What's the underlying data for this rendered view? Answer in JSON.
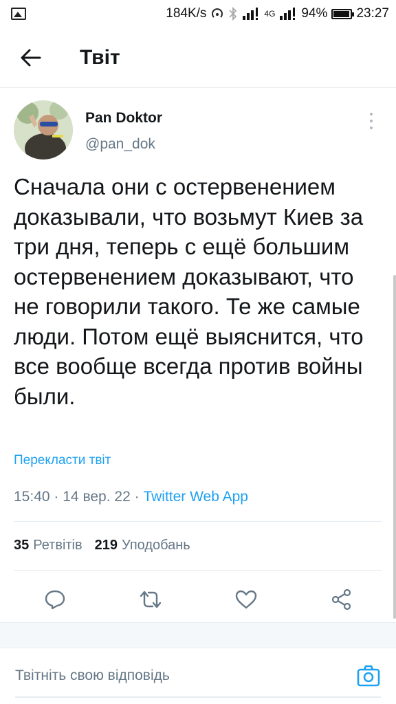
{
  "status_bar": {
    "speed": "184K/s",
    "network_label": "4G",
    "battery_percent": "94%",
    "battery_level": 0.94,
    "time": "23:27"
  },
  "header": {
    "title": "Твіт",
    "back_icon": "arrow-left-icon"
  },
  "tweet": {
    "author_name": "Pan Doktor",
    "author_handle": "@pan_dok",
    "text": "Сначала они с остервенением доказывали, что возьмут Киев за три дня, теперь с ещё большим остервенением доказывают, что не говорили такого. Те же самые люди. Потом ещё выяснится, что все вообще всегда против войны были.",
    "translate_label": "Перекласти твіт",
    "time": "15:40",
    "date": "14 вер. 22",
    "separator": "·",
    "source": "Twitter Web App",
    "retweets_count": "35",
    "retweets_label": "Ретвітів",
    "likes_count": "219",
    "likes_label": "Уподобань"
  },
  "actions": {
    "icons": [
      "reply-icon",
      "retweet-icon",
      "like-icon",
      "share-icon"
    ]
  },
  "reply": {
    "placeholder": "Твітніть свою відповідь",
    "camera_icon": "camera-icon"
  },
  "colors": {
    "accent": "#1da1f2",
    "secondary_text": "#657786",
    "divider": "#e6ecf0"
  }
}
